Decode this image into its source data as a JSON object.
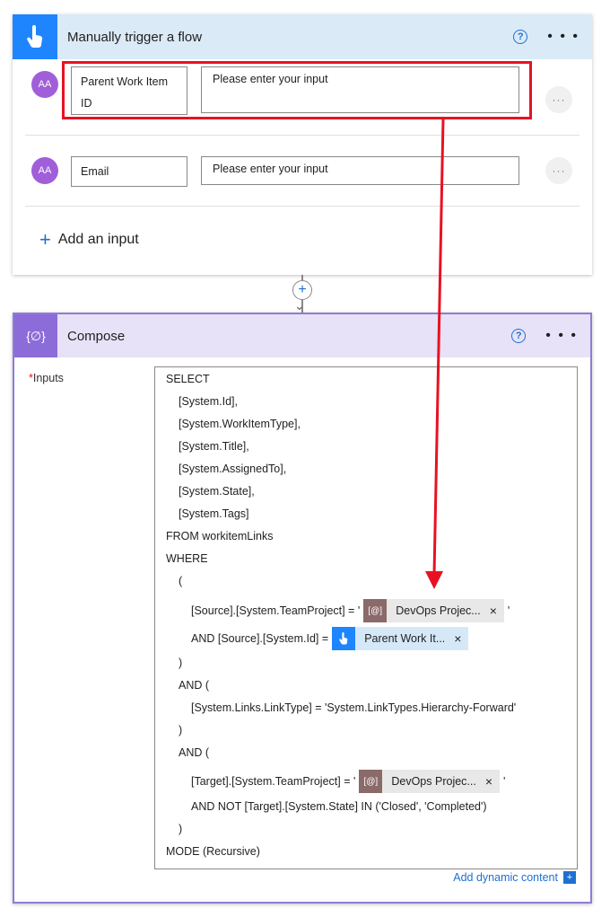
{
  "trigger": {
    "title": "Manually trigger a flow",
    "help_glyph": "?",
    "more_glyph": "• • •",
    "inputs": [
      {
        "avatar": "AA",
        "name_line1": "Parent Work Item",
        "name_line2": "ID",
        "placeholder": "Please enter your input",
        "more_glyph": "···"
      },
      {
        "avatar": "AA",
        "name_line1": "Email",
        "name_line2": "",
        "placeholder": "Please enter your input",
        "more_glyph": "···"
      }
    ],
    "add_input_plus": "+",
    "add_input_label": "Add an input"
  },
  "connector": {
    "plus_glyph": "+",
    "arrow_glyph": "⌄"
  },
  "compose": {
    "title": "Compose",
    "icon_glyph": "{∅}",
    "help_glyph": "?",
    "more_glyph": "• • •",
    "inputs_required": "*",
    "inputs_label": "Inputs",
    "lines": [
      "SELECT",
      "[System.Id],",
      "[System.WorkItemType],",
      "[System.Title],",
      "[System.AssignedTo],",
      "[System.State],",
      "[System.Tags]",
      "FROM workitemLinks",
      "WHERE",
      "(",
      "[Source].[System.TeamProject] = '",
      "AND [Source].[System.Id] =",
      ")",
      "AND (",
      "[System.Links.LinkType] = 'System.LinkTypes.Hierarchy-Forward'",
      ")",
      "AND (",
      "[Target].[System.TeamProject] = '",
      "AND NOT [Target].[System.State] IN ('Closed', 'Completed')",
      ")",
      "MODE (Recursive)"
    ],
    "quote_close": "'",
    "token_devops": {
      "icon": "[@]",
      "label": "DevOps Projec...",
      "close": "×"
    },
    "token_trigger": {
      "label": "Parent Work It...",
      "close": "×"
    },
    "add_dynamic_label": "Add dynamic content",
    "add_dynamic_plus": "+"
  },
  "colors": {
    "trigger_accent": "#1f85ff",
    "compose_accent": "#8c6cd9",
    "highlight": "#e81123",
    "link": "#1f6fd1"
  }
}
